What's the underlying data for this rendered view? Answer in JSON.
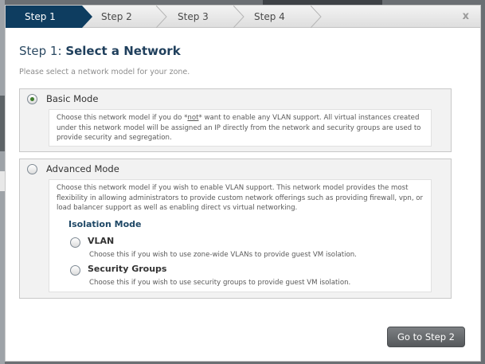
{
  "steps": [
    {
      "label": "Step 1",
      "active": true
    },
    {
      "label": "Step 2",
      "active": false
    },
    {
      "label": "Step 3",
      "active": false
    },
    {
      "label": "Step 4",
      "active": false
    }
  ],
  "dialog": {
    "close_label": "x",
    "title_prefix": "Step 1:",
    "title_main": "Select a Network",
    "subtitle": "Please select a network model for your zone."
  },
  "basic_mode": {
    "label": "Basic Mode",
    "selected": true,
    "desc_part1": "Choose this network model if you do *",
    "desc_emph": "not",
    "desc_part2": "* want to enable any VLAN support. All virtual instances created under this network model will be assigned an IP directly from the network and security groups are used to provide security and segregation."
  },
  "advanced_mode": {
    "label": "Advanced Mode",
    "selected": false,
    "desc": "Choose this network model if you wish to enable VLAN support. This network model provides the most flexibility in allowing administrators to provide custom network offerings such as providing firewall, vpn, or load balancer support as well as enabling direct vs virtual networking.",
    "isolation_title": "Isolation Mode",
    "options": [
      {
        "label": "VLAN",
        "desc": "Choose this if you wish to use zone-wide VLANs to provide guest VM isolation."
      },
      {
        "label": "Security Groups",
        "desc": "Choose this if you wish to use security groups to provide guest VM isolation."
      }
    ]
  },
  "footer": {
    "next_button": "Go to Step 2"
  },
  "colors": {
    "active_step": "#0e3d60",
    "title": "#1f3f5c",
    "radio_selected": "#3f7d2c"
  }
}
